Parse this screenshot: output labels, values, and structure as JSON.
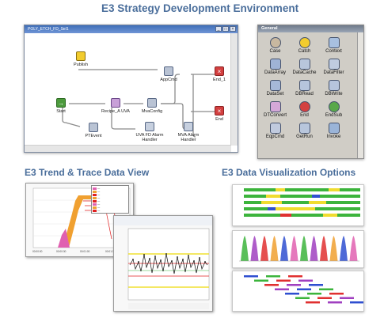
{
  "sections": {
    "strategy": "E3 Strategy Development Environment",
    "trend": "E3 Trend & Trace Data View",
    "viz": "E3 Data Visualization Options"
  },
  "workflow": {
    "window_title": "POLY_ETCH_FD_Sel1",
    "nodes": {
      "publish": "Publish",
      "start": "Start",
      "recipe": "Recipe_A UVA",
      "mvaconfig": "MvaConfig",
      "appcmd": "AppCmd",
      "end1": "End_1",
      "end": "End",
      "mva_alarm": "MVA Alarm Handler",
      "ptevent": "PTEvent",
      "uva_alarm": "UVA FD Alarm Handler"
    }
  },
  "palette": {
    "title": "General",
    "items": [
      "Case",
      "Catch",
      "Context",
      "DataArray",
      "DataCache",
      "DataFilter",
      "DataSet",
      "DBRead",
      "DBWrite",
      "DTConvert",
      "End",
      "EndSub",
      "EqpCmd",
      "GetRun",
      "Invoke"
    ],
    "icons": [
      "case-icon",
      "catch-icon",
      "context-icon",
      "data-array-icon",
      "data-cache-icon",
      "data-filter-icon",
      "data-set-icon",
      "db-read-icon",
      "db-write-icon",
      "dt-convert-icon",
      "end-icon",
      "end-sub-icon",
      "eqp-cmd-icon",
      "get-run-icon",
      "invoke-icon"
    ]
  },
  "colors": {
    "title": "#4a6e9b",
    "end": "#d34040",
    "start": "#4c9a3c",
    "trace_orange": "#f0a030",
    "trace_pink": "#e060b0",
    "limit_red": "#e02020",
    "limit_yellow": "#f0e030",
    "bar_green": "#3cb43c",
    "bar_yellow": "#f0dc30",
    "bar_blue": "#2f4fd0",
    "bar_red": "#e03030",
    "bar_purple": "#a040c0"
  }
}
